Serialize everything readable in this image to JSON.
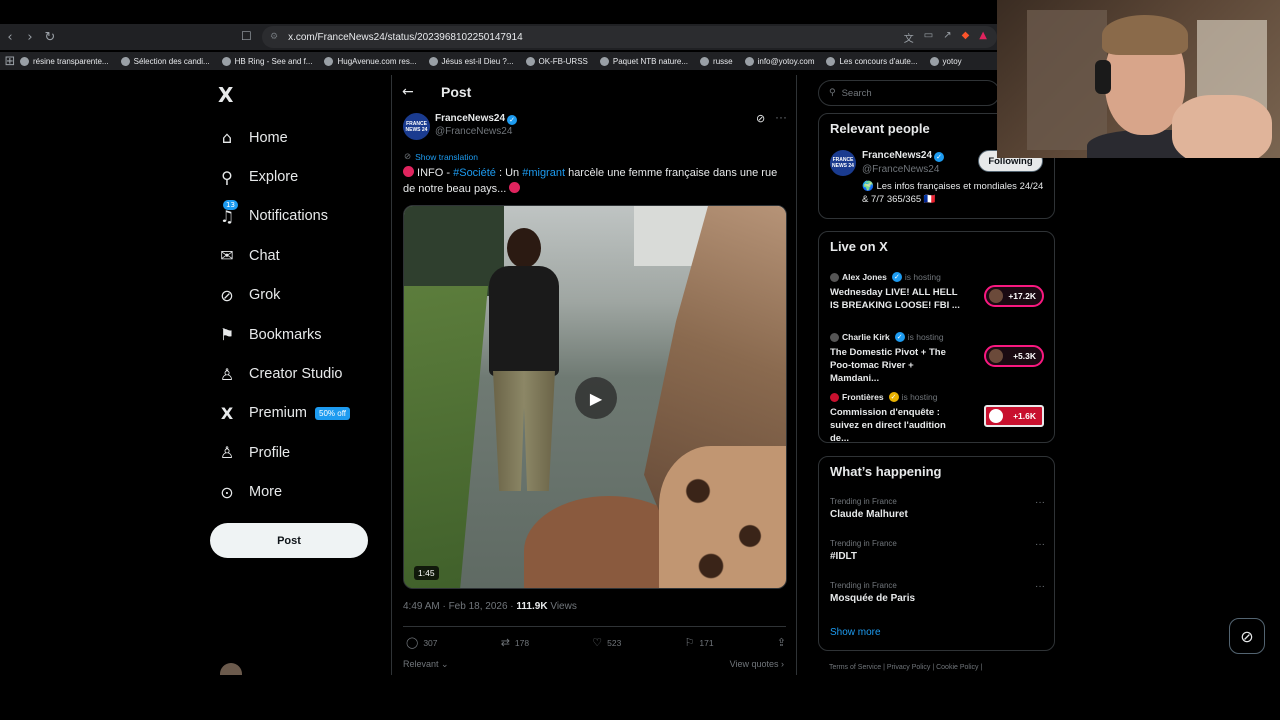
{
  "browser": {
    "url": "x.com/FranceNews24/status/2023968102250147914",
    "bookmarks": [
      "résine transparente...",
      "Sélection des candi...",
      "HB Ring - See and f...",
      "HugAvenue.com res...",
      "Jésus est-il Dieu ?...",
      "OK-FB-URSS",
      "Paquet NTB nature...",
      "russe",
      "info@yotoy.com",
      "Les concours d'aute...",
      "yotoy"
    ]
  },
  "sidebar": {
    "logo": "X",
    "items": [
      {
        "label": "Home",
        "icon": "home-icon",
        "glyph": "⌂"
      },
      {
        "label": "Explore",
        "icon": "search-icon",
        "glyph": "⚲"
      },
      {
        "label": "Notifications",
        "icon": "bell-icon",
        "glyph": "🔔︎",
        "badge": "13"
      },
      {
        "label": "Chat",
        "icon": "mail-icon",
        "glyph": "✉"
      },
      {
        "label": "Grok",
        "icon": "grok-icon",
        "glyph": "⊘"
      },
      {
        "label": "Bookmarks",
        "icon": "bookmark-icon",
        "glyph": "⚑"
      },
      {
        "label": "Creator Studio",
        "icon": "creator-icon",
        "glyph": "♙"
      },
      {
        "label": "Premium",
        "icon": "x-premium-icon",
        "glyph": "𝕏",
        "badge": "50% off"
      },
      {
        "label": "Profile",
        "icon": "person-icon",
        "glyph": "♙"
      },
      {
        "label": "More",
        "icon": "more-circle-icon",
        "glyph": "⊙"
      }
    ],
    "post_button": "Post"
  },
  "main": {
    "title": "Post",
    "author": {
      "name": "FranceNews24",
      "handle": "@FranceNews24",
      "avatar_text": "FRANCE NEWS 24"
    },
    "translate_label": "Show translation",
    "tweet": {
      "part1": " INFO - ",
      "tag1": "#Société",
      "part2": " : Un ",
      "tag2": "#migrant",
      "part3": " harcèle une femme française dans une rue de notre beau pays... "
    },
    "video_duration": "1:45",
    "timestamp": "4:49 AM · Feb 18, 2026 · ",
    "views_count": "111.9K",
    "views_label": " Views",
    "actions": {
      "replies": "307",
      "reposts": "178",
      "likes": "523",
      "bookmarks": "171"
    },
    "relevant_label": "Relevant",
    "view_quotes_label": "View quotes"
  },
  "right": {
    "search_placeholder": "Search",
    "relevant_people": {
      "title": "Relevant people",
      "name": "FranceNews24",
      "handle": "@FranceNews24",
      "follow_label": "Following",
      "bio": "🌍 Les infos françaises et mondiales 24/24 & 7/7 365/365 🇫🇷"
    },
    "live": {
      "title": "Live on X",
      "items": [
        {
          "host": "Alex Jones",
          "status": "is hosting",
          "title": "Wednesday LIVE! ALL HELL IS BREAKING LOOSE! FBI ...",
          "count": "+17.2K"
        },
        {
          "host": "Charlie Kirk",
          "status": "is hosting",
          "title": "The Domestic Pivot + The Poo-tomac River + Mamdani...",
          "count": "+5.3K"
        },
        {
          "host": "Frontières",
          "status": "is hosting",
          "title": "Commission d'enquête : suivez en direct l'audition de...",
          "count": "+1.6K"
        }
      ]
    },
    "happening": {
      "title": "What’s happening",
      "trends": [
        {
          "context": "Trending in France",
          "name": "Claude Malhuret"
        },
        {
          "context": "Trending in France",
          "name": "#IDLT"
        },
        {
          "context": "Trending in France",
          "name": "Mosquée de Paris"
        }
      ],
      "show_more": "Show more"
    },
    "footer": "Terms of Service  |  Privacy Policy  |  Cookie Policy  |"
  },
  "colors": {
    "accent": "#1d9bf0",
    "background": "#000000",
    "border": "#2f3336",
    "live_ring": "#f91880"
  }
}
